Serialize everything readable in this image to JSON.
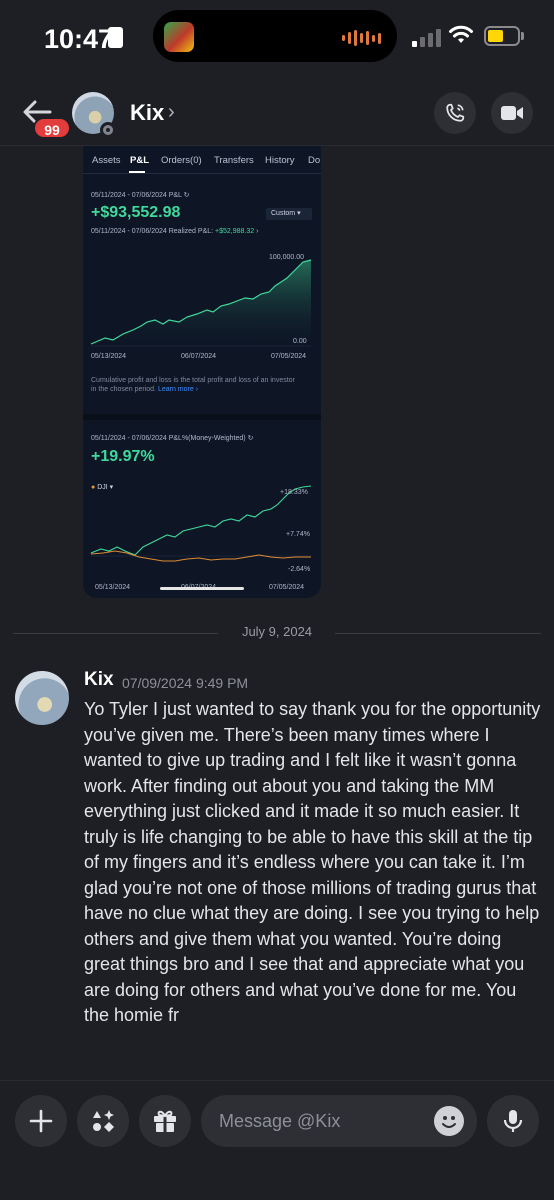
{
  "status_bar": {
    "time": "10:47",
    "battery_level": 0.55
  },
  "header": {
    "unread_count": "99",
    "name": "Kix",
    "chevron": "›",
    "call_icon": "phone-icon",
    "video_icon": "video-camera-icon"
  },
  "shared_image": {
    "tabs": [
      "Assets",
      "P&L",
      "Orders(0)",
      "Transfers",
      "History",
      "Do"
    ],
    "active_tab": "P&L",
    "pnl_range": "05/11/2024 - 07/06/2024 P&L",
    "pnl_value": "+$93,552.98",
    "period_select": "Custom",
    "realized_label": "05/11/2024 - 07/06/2024 Realized P&L:",
    "realized_value": "+$52,988.32",
    "y_top": "100,000.00",
    "y_bottom": "0.00",
    "x_ticks": [
      "05/13/2024",
      "06/07/2024",
      "07/05/2024"
    ],
    "note": "Cumulative profit and loss is the total profit and loss of an investor in the chosen period.",
    "learn_more": "Learn more",
    "pct_range": "05/11/2024 - 07/06/2024 P&L%(Money-Weighted)",
    "pct_value": "+19.97%",
    "benchmark": "DJI",
    "pct_ticks": [
      "+18.33%",
      "+7.74%",
      "-2.64%"
    ]
  },
  "divider": {
    "date": "July 9, 2024"
  },
  "message": {
    "author": "Kix",
    "timestamp": "07/09/2024 9:49 PM",
    "text": "Yo Tyler I just wanted to say thank you for the opportunity you’ve given me. There’s been many times where I wanted to give up trading and I felt like it wasn’t gonna work. After finding out about you and taking the MM everything just clicked and it made it so much easier. It truly is life changing to be able to have this skill at the tip of my fingers and it’s endless where you can take it. I’m glad you’re not one of those millions of trading gurus that have no clue what they are doing. I see you trying to help others and give them what you wanted. You’re doing great things bro and I see that and appreciate what you are doing for others and what you’ve done for me. You the homie fr"
  },
  "composer": {
    "placeholder": "Message @Kix"
  },
  "colors": {
    "background": "#1e1f24",
    "accent_green": "#3fd99b",
    "badge_red": "#e23c3c",
    "link_blue": "#3c8dff"
  }
}
